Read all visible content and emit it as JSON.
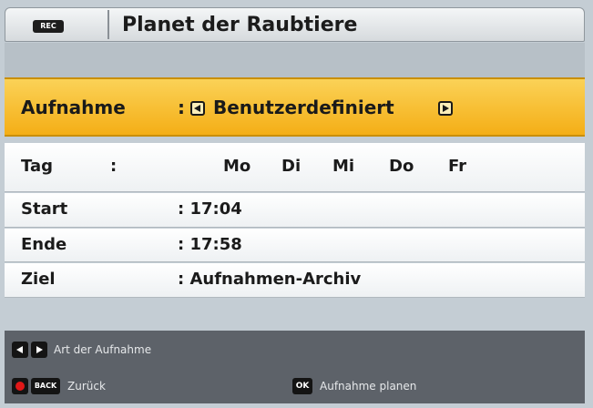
{
  "title": {
    "rec_badge": "REC",
    "text": "Planet der Raubtiere"
  },
  "mode": {
    "label": "Aufnahme",
    "colon": ":",
    "value": "Benutzerdefiniert",
    "left_icon": "left-arrow-icon",
    "right_icon": "right-arrow-icon"
  },
  "days": {
    "label": "Tag",
    "colon": ":",
    "items": [
      "Mo",
      "Di",
      "Mi",
      "Do",
      "Fr"
    ]
  },
  "start": {
    "label": "Start",
    "value": ": 17:04"
  },
  "end": {
    "label": "Ende",
    "value": ": 17:58"
  },
  "target": {
    "label": "Ziel",
    "value": ": Aufnahmen-Archiv"
  },
  "footer": {
    "art_hint": "Art der Aufnahme",
    "back_key": "BACK",
    "back_hint": "Zurück",
    "ok_key": "OK",
    "ok_hint": "Aufnahme planen"
  },
  "colors": {
    "highlight": "#f4ae16",
    "footer_bg": "#5d6269",
    "red_button": "#e01818"
  }
}
